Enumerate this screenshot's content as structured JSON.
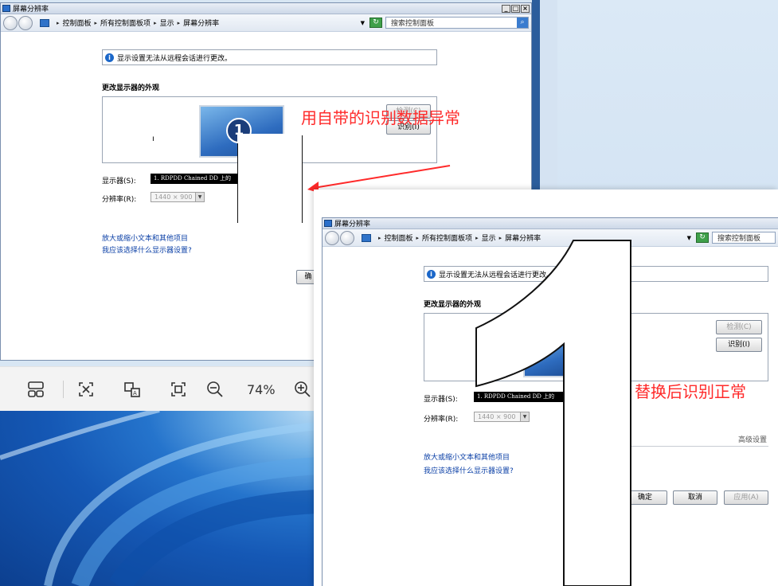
{
  "left_window": {
    "title": "屏幕分辨率",
    "breadcrumb": [
      "控制面板",
      "所有控制面板项",
      "显示",
      "屏幕分辨率"
    ],
    "search_placeholder": "搜索控制面板",
    "info_text": "显示设置无法从远程会话进行更改。",
    "heading": "更改显示器的外观",
    "detect_label": "检测(C)",
    "identify_label": "识别(I)",
    "monitor_number": "1",
    "display_label": "显示器(S):",
    "display_value": "1. RDPDD Chained DD 上的",
    "resolution_label": "分辨率(R):",
    "resolution_value": "1440 × 900",
    "link_text_size": "放大或缩小文本和其他项目",
    "link_which_display": "我应该选择什么显示器设置?",
    "ok_partial": "确"
  },
  "right_window": {
    "title": "屏幕分辨率",
    "breadcrumb": [
      "控制面板",
      "所有控制面板项",
      "显示",
      "屏幕分辨率"
    ],
    "search_placeholder": "搜索控制面板",
    "info_text": "显示设置无法从远程会话进行更改。",
    "heading": "更改显示器的外观",
    "detect_label": "检测(C)",
    "identify_label": "识别(I)",
    "display_label": "显示器(S):",
    "display_value": "1. RDPDD Chained DD 上的",
    "resolution_label": "分辨率(R):",
    "resolution_value": "1440 × 900",
    "advanced_link": "高级设置",
    "link_text_size": "放大或缩小文本和其他项目",
    "link_which_display": "我应该选择什么显示器设置?",
    "ok_label": "确定",
    "cancel_label": "取消",
    "apply_label": "应用(A)",
    "big_number": "1"
  },
  "annotations": {
    "top": "用自带的识别数据异常",
    "bottom": "替换后识别正常",
    "color": "#ff2a2a"
  },
  "viewer_toolbar": {
    "zoom": "74%"
  }
}
